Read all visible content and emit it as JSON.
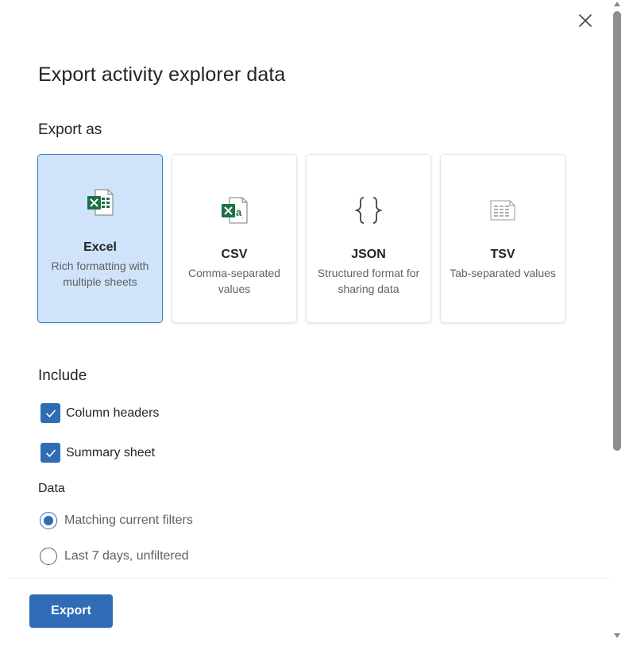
{
  "dialog": {
    "title": "Export activity explorer data",
    "export_as_label": "Export as",
    "formats": [
      {
        "name": "Excel",
        "description": "Rich formatting with multiple sheets",
        "icon": "excel-icon",
        "selected": true
      },
      {
        "name": "CSV",
        "description": "Comma-separated values",
        "icon": "csv-icon",
        "selected": false
      },
      {
        "name": "JSON",
        "description": "Structured format for sharing data",
        "icon": "json-braces-icon",
        "selected": false
      },
      {
        "name": "TSV",
        "description": "Tab-separated values",
        "icon": "tsv-icon",
        "selected": false
      }
    ],
    "include_label": "Include",
    "include_options": [
      {
        "label": "Column headers",
        "checked": true
      },
      {
        "label": "Summary sheet",
        "checked": true
      }
    ],
    "data_label": "Data",
    "data_options": [
      {
        "label": "Matching current filters",
        "selected": true
      },
      {
        "label": "Last 7 days, unfiltered",
        "selected": false
      }
    ],
    "export_button": "Export"
  },
  "colors": {
    "accent": "#2f6cb5",
    "selected_card_bg": "#cfe3fb",
    "excel_green": "#1e7145",
    "text_primary": "#242424",
    "text_secondary": "#616161"
  }
}
